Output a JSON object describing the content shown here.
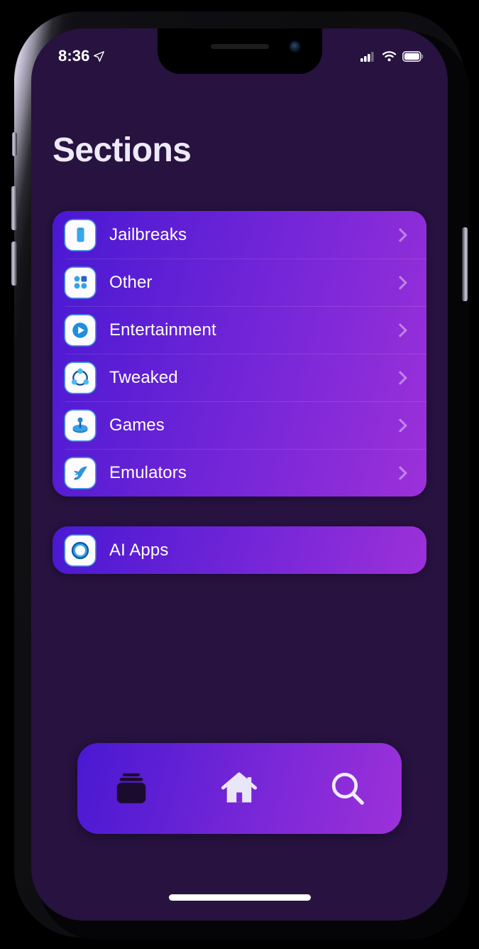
{
  "device": {
    "frame": "iphone-x",
    "notch": true
  },
  "status_bar": {
    "time": "8:36",
    "location_icon": "location-arrow-icon",
    "cellular_icon": "cellular-signal-icon",
    "wifi_icon": "wifi-icon",
    "battery_icon": "battery-icon"
  },
  "page": {
    "title": "Sections"
  },
  "theme": {
    "background": "#271240",
    "gradient_start": "#4A18D2",
    "gradient_end": "#9C31D9",
    "icon_tile": "#FDFDFF",
    "icon_accent": "#2D9BE0",
    "text": "#FFFFFF",
    "title_text": "#ECEAF7"
  },
  "sections_list": [
    {
      "label": "Jailbreaks",
      "icon": "phone-icon",
      "chevron": "chevron-right-icon"
    },
    {
      "label": "Other",
      "icon": "app-grid-icon",
      "chevron": "chevron-right-icon"
    },
    {
      "label": "Entertainment",
      "icon": "play-circle-icon",
      "chevron": "chevron-right-icon"
    },
    {
      "label": "Tweaked",
      "icon": "share-nodes-icon",
      "chevron": "chevron-right-icon"
    },
    {
      "label": "Games",
      "icon": "joystick-icon",
      "chevron": "chevron-right-icon"
    },
    {
      "label": "Emulators",
      "icon": "dolphin-icon",
      "chevron": "chevron-right-icon"
    }
  ],
  "secondary_list": [
    {
      "label": "AI Apps",
      "icon": "ring-circle-icon"
    }
  ],
  "tab_bar": {
    "items": [
      {
        "name": "sections",
        "icon": "stack-cards-icon",
        "selected": true
      },
      {
        "name": "home",
        "icon": "house-icon",
        "selected": false
      },
      {
        "name": "search",
        "icon": "magnifier-icon",
        "selected": false
      }
    ]
  }
}
